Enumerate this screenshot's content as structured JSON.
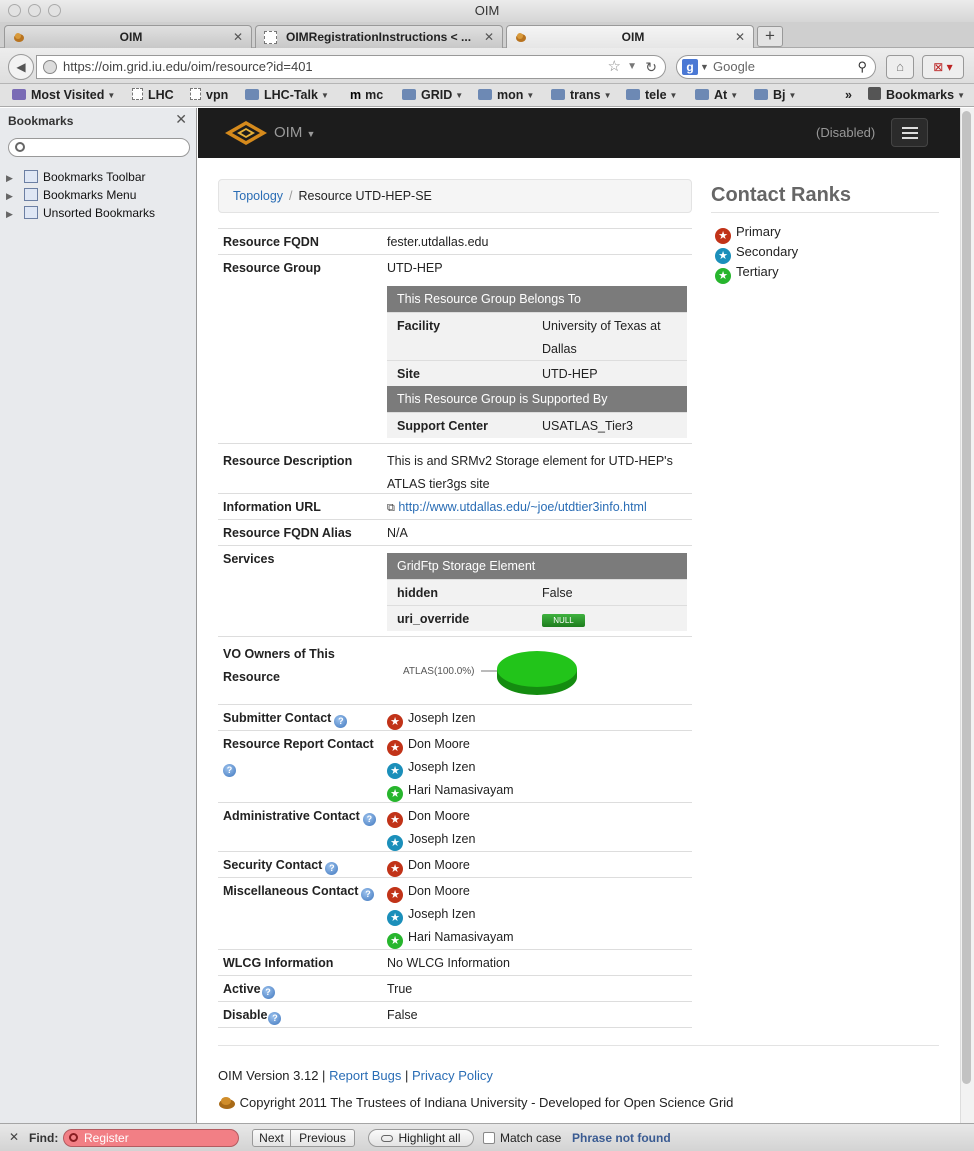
{
  "window": {
    "title": "OIM"
  },
  "tabs": [
    {
      "label": "OIM"
    },
    {
      "label": "OIMRegistrationInstructions < ..."
    },
    {
      "label": "OIM"
    }
  ],
  "nav": {
    "url": "https://oim.grid.iu.edu/oim/resource?id=401",
    "search_placeholder": "Google"
  },
  "bookmarks_bar": [
    {
      "label": "Most Visited"
    },
    {
      "label": "LHC"
    },
    {
      "label": "vpn"
    },
    {
      "label": "LHC-Talk"
    },
    {
      "label": "mc"
    },
    {
      "label": "GRID"
    },
    {
      "label": "mon"
    },
    {
      "label": "trans"
    },
    {
      "label": "tele"
    },
    {
      "label": "At"
    },
    {
      "label": "Bj"
    },
    {
      "label": "Bookmarks"
    }
  ],
  "sidebar": {
    "title": "Bookmarks",
    "items": [
      {
        "label": "Bookmarks Toolbar"
      },
      {
        "label": "Bookmarks Menu"
      },
      {
        "label": "Unsorted Bookmarks"
      }
    ]
  },
  "oim": {
    "brand": "OIM",
    "status": "(Disabled)"
  },
  "breadcrumb": {
    "link": "Topology",
    "current": "Resource UTD-HEP-SE"
  },
  "details": {
    "fqdn_label": "Resource FQDN",
    "fqdn": "fester.utdallas.edu",
    "group_label": "Resource Group",
    "group": "UTD-HEP",
    "belongs_header": "This Resource Group Belongs To",
    "facility_label": "Facility",
    "facility_line1": "University of Texas at",
    "facility_line2": "Dallas",
    "site_label": "Site",
    "site": "UTD-HEP",
    "supported_header": "This Resource Group is Supported By",
    "support_label": "Support Center",
    "support": "USATLAS_Tier3",
    "desc_label": "Resource Description",
    "desc_line1": "This is and SRMv2 Storage element for UTD-HEP's",
    "desc_line2": "ATLAS tier3gs site",
    "url_label": "Information URL",
    "url": "http://www.utdallas.edu/~joe/utdtier3info.html",
    "alias_label": "Resource FQDN Alias",
    "alias": "N/A",
    "services_label": "Services",
    "service_header": "GridFtp Storage Element",
    "hidden_label": "hidden",
    "hidden": "False",
    "uri_label": "uri_override",
    "uri_value": "NULL",
    "vo_label_line1": "VO Owners of This",
    "vo_label_line2": "Resource",
    "vo_pie_label": "ATLAS(100.0%)",
    "submitter_label": "Submitter Contact",
    "report_label": "Resource Report Contact",
    "admin_label": "Administrative Contact",
    "security_label": "Security Contact",
    "misc_label": "Miscellaneous Contact",
    "wlcg_label": "WLCG Information",
    "wlcg": "No WLCG Information",
    "active_label": "Active",
    "active": "True",
    "disable_label": "Disable",
    "disable": "False"
  },
  "contacts": {
    "submitter": [
      "Joseph Izen"
    ],
    "report": [
      "Don Moore",
      "Joseph Izen",
      "Hari Namasivayam"
    ],
    "admin": [
      "Don Moore",
      "Joseph Izen"
    ],
    "security": [
      "Don Moore"
    ],
    "misc": [
      "Don Moore",
      "Joseph Izen",
      "Hari Namasivayam"
    ]
  },
  "ranks": {
    "title": "Contact Ranks",
    "primary": "Primary",
    "secondary": "Secondary",
    "tertiary": "Tertiary"
  },
  "footer": {
    "version": "OIM Version 3.12 |",
    "report_bugs": "Report Bugs",
    "sep": "|",
    "privacy": "Privacy Policy",
    "copyright": "Copyright 2011 The Trustees of Indiana University - Developed for Open Science Grid"
  },
  "findbar": {
    "label": "Find:",
    "value": "Register",
    "next": "Next",
    "previous": "Previous",
    "highlight": "Highlight all",
    "match_case": "Match case",
    "status": "Phrase not found"
  },
  "colors": {
    "link": "#2a6db5",
    "primary": "#c13318",
    "secondary": "#1b8fba",
    "tertiary": "#27b52d",
    "pie": "#22c41a"
  }
}
